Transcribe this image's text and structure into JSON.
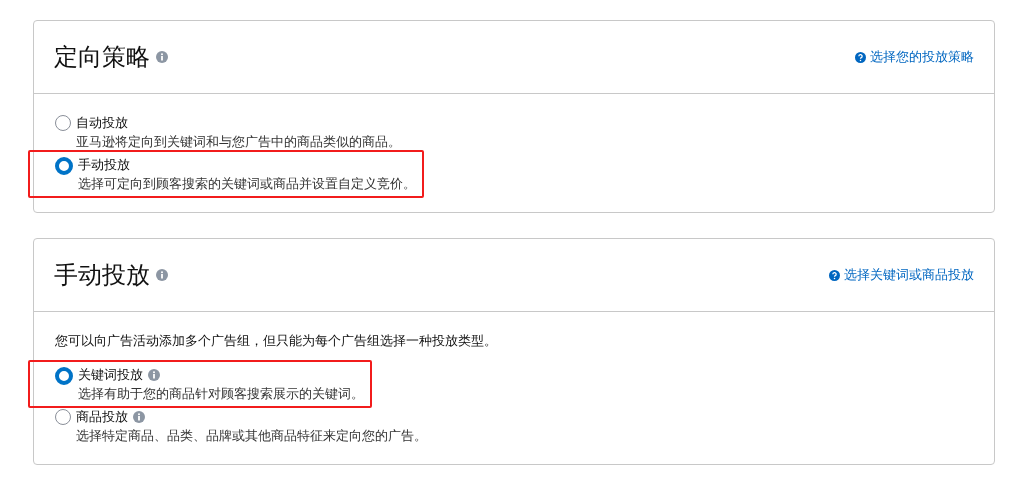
{
  "sections": [
    {
      "title": "定向策略",
      "help_link": "选择您的投放策略",
      "options": [
        {
          "label": "自动投放",
          "info": false,
          "description": "亚马逊将定向到关键词和与您广告中的商品类似的商品。",
          "selected": false,
          "highlighted": false
        },
        {
          "label": "手动投放",
          "info": false,
          "description": "选择可定向到顾客搜索的关键词或商品并设置自定义竞价。",
          "selected": true,
          "highlighted": true
        }
      ]
    },
    {
      "title": "手动投放",
      "help_link": "选择关键词或商品投放",
      "intro": "您可以向广告活动添加多个广告组，但只能为每个广告组选择一种投放类型。",
      "options": [
        {
          "label": "关键词投放",
          "info": true,
          "description": "选择有助于您的商品针对顾客搜索展示的关键词。",
          "selected": true,
          "highlighted": true
        },
        {
          "label": "商品投放",
          "info": true,
          "description": "选择特定商品、品类、品牌或其他商品特征来定向您的广告。",
          "selected": false,
          "highlighted": false
        }
      ]
    }
  ]
}
